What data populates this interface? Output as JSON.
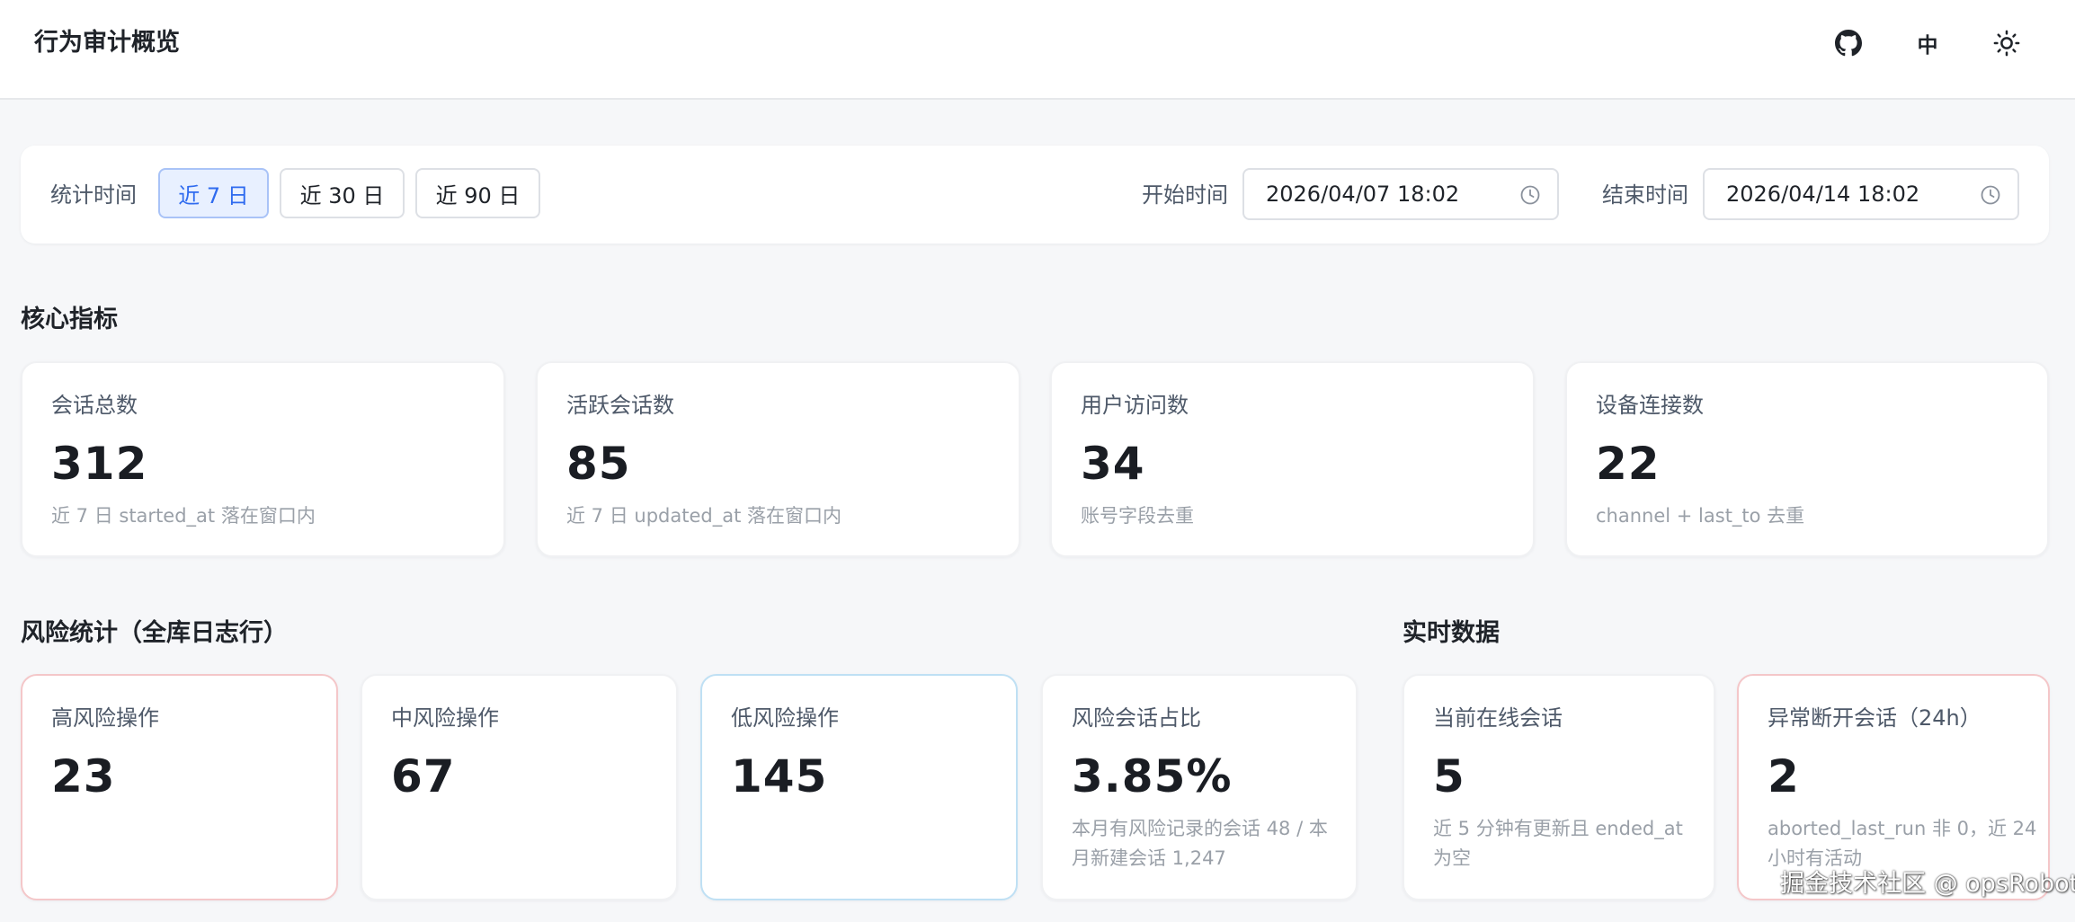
{
  "header": {
    "title": "行为审计概览",
    "icons": [
      "github-icon",
      "language-toggle",
      "sun-icon"
    ],
    "language_label": "中"
  },
  "filter": {
    "label": "统计时间",
    "ranges": [
      {
        "label": "近 7 日",
        "active": true
      },
      {
        "label": "近 30 日",
        "active": false
      },
      {
        "label": "近 90 日",
        "active": false
      }
    ],
    "start_label": "开始时间",
    "start_value": "2026/04/07 18:02",
    "end_label": "结束时间",
    "end_value": "2026/04/14 18:02"
  },
  "core": {
    "title": "核心指标",
    "cards": [
      {
        "label": "会话总数",
        "value": "312",
        "note": "近 7 日 started_at 落在窗口内"
      },
      {
        "label": "活跃会话数",
        "value": "85",
        "note": "近 7 日 updated_at 落在窗口内"
      },
      {
        "label": "用户访问数",
        "value": "34",
        "note": "账号字段去重"
      },
      {
        "label": "设备连接数",
        "value": "22",
        "note": "channel + last_to 去重"
      }
    ]
  },
  "risk": {
    "title": "风险统计（全库日志行）",
    "cards": [
      {
        "label": "高风险操作",
        "value": "23",
        "note": ""
      },
      {
        "label": "中风险操作",
        "value": "67",
        "note": ""
      },
      {
        "label": "低风险操作",
        "value": "145",
        "note": ""
      },
      {
        "label": "风险会话占比",
        "value": "3.85%",
        "note": "本月有风险记录的会话 48 / 本月新建会话 1,247"
      }
    ]
  },
  "realtime": {
    "title": "实时数据",
    "cards": [
      {
        "label": "当前在线会话",
        "value": "5",
        "note": "近 5 分钟有更新且 ended_at 为空"
      },
      {
        "label": "异常断开会话（24h）",
        "value": "2",
        "note": "aborted_last_run 非 0，近 24 小时有活动"
      }
    ]
  },
  "colors": {
    "accent": "#2f6bef",
    "high_risk_border": "#f4c7c9",
    "low_risk_border": "#bfe0f4"
  },
  "watermark": "掘金技术社区 @ opsRobot"
}
